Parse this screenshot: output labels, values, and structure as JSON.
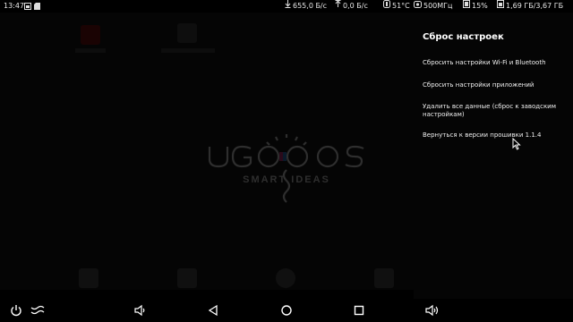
{
  "status_bar": {
    "time": "13:47",
    "download_speed": "655,0 Б/с",
    "upload_speed": "0,0 Б/с",
    "temperature": "51°C",
    "cpu_freq": "500МГц",
    "cpu_load": "15%",
    "memory": "1,69 ГБ/3,67 ГБ",
    "icons": [
      "image-icon",
      "sd-card-icon",
      "download-arrow-icon",
      "upload-arrow-icon",
      "thermometer-icon",
      "cpu-chip-icon",
      "processor-icon",
      "memory-icon"
    ]
  },
  "panel": {
    "title": "Сброс настроек",
    "items": [
      {
        "label": "Сбросить настройки Wi-Fi и Bluetooth"
      },
      {
        "label": "Сбросить настройки приложений"
      },
      {
        "label": "Удалить все данные (сброс к заводским настройкам)"
      },
      {
        "label": "Вернуться к версии прошивки 1.1.4"
      }
    ]
  },
  "logo": {
    "text_top": "UGOOS",
    "text_bottom": "SMART IDEAS"
  },
  "navbar": {
    "icons": [
      "power-icon",
      "menu-wave-icon",
      "volume-down-icon",
      "back-icon",
      "home-icon",
      "recents-icon",
      "volume-up-icon"
    ]
  },
  "colors": {
    "background": "#000000",
    "panel": "#050505",
    "text": "#f0f0f0"
  }
}
